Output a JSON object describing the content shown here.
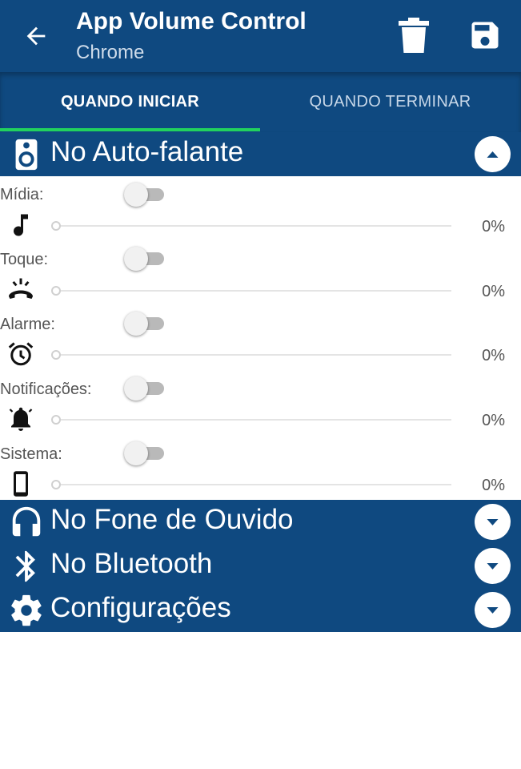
{
  "appbar": {
    "title": "App Volume Control",
    "subtitle": "Chrome",
    "back_icon": "arrow-back-icon",
    "delete_icon": "trash-icon",
    "save_icon": "floppy-save-icon"
  },
  "tabs": [
    {
      "label": "QUANDO INICIAR",
      "selected": true
    },
    {
      "label": "QUANDO TERMINAR",
      "selected": false
    }
  ],
  "sections": {
    "speaker": {
      "label": "No Auto-falante",
      "icon": "speaker-icon",
      "expanded": true
    },
    "headphones": {
      "label": "No Fone de Ouvido",
      "icon": "headphones-icon",
      "expanded": false
    },
    "bluetooth": {
      "label": "No Bluetooth",
      "icon": "bluetooth-icon",
      "expanded": false
    },
    "settings": {
      "label": "Configurações",
      "icon": "gear-icon",
      "expanded": false
    }
  },
  "rows": [
    {
      "label": "Mídia:",
      "icon": "music-note-icon",
      "enabled": false,
      "value": "0%"
    },
    {
      "label": "Toque:",
      "icon": "ringing-phone-icon",
      "enabled": false,
      "value": "0%"
    },
    {
      "label": "Alarme:",
      "icon": "alarm-clock-icon",
      "enabled": false,
      "value": "0%"
    },
    {
      "label": "Notificações:",
      "icon": "bell-icon",
      "enabled": false,
      "value": "0%"
    },
    {
      "label": "Sistema:",
      "icon": "smartphone-icon",
      "enabled": false,
      "value": "0%"
    }
  ],
  "colors": {
    "primary": "#0f4980",
    "tab_indicator": "#22d15e",
    "toggle_track_off": "#b9b9b9"
  }
}
